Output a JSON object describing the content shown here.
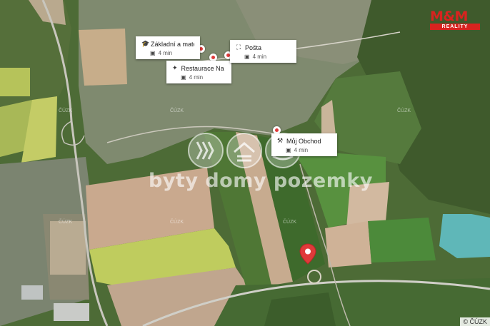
{
  "map": {
    "branding": {
      "top": "M&M",
      "bottom": "REALITY"
    },
    "watermark": "byty domy pozemky",
    "source_marks": [
      "ČÚZK",
      "ČÚZK",
      "ČÚZK",
      "ČÚZK",
      "ČÚZK",
      "ČÚZK"
    ],
    "copyright": "© ČÚZK"
  },
  "pois": [
    {
      "name": "Základní a mateř...",
      "icon": "school-icon",
      "time": "4 min"
    },
    {
      "name": "Restaurace Na Sc...",
      "icon": "restaurant-icon",
      "time": "4 min"
    },
    {
      "name": "Pošta",
      "icon": "post-office-icon",
      "time": "4 min"
    },
    {
      "name": "Můj Obchod",
      "icon": "shop-icon",
      "time": "4 min"
    }
  ],
  "colors": {
    "pin": "#e03a3a",
    "brand": "#d8231f",
    "lake": "#5fb7b8"
  }
}
